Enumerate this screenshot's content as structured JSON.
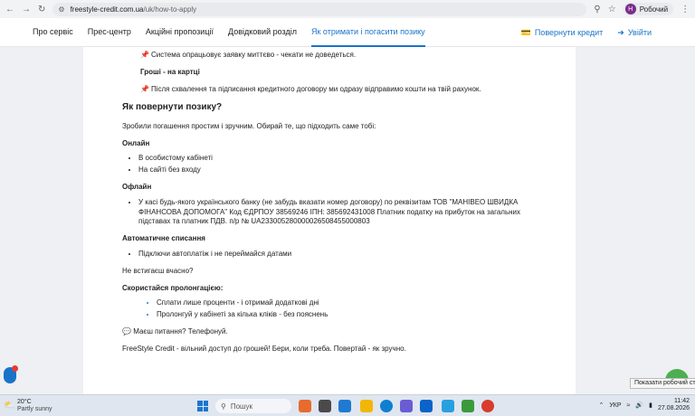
{
  "browser": {
    "url_domain": "freestyle-credit.com.ua",
    "url_path": "/uk/how-to-apply",
    "profile_initial": "Н",
    "profile_name": "Робочий"
  },
  "header": {
    "nav": [
      {
        "label": "Про сервіс"
      },
      {
        "label": "Прес-центр"
      },
      {
        "label": "Акційні пропозиції"
      },
      {
        "label": "Довідковий розділ"
      },
      {
        "label": "Як отримати і погасити позику"
      }
    ],
    "repay_label": "Повернути кредит",
    "login_label": "Увійти"
  },
  "content": {
    "line1": "Система опрацьовує заявку миттєво - чекати не доведеться.",
    "money_card_heading": "Гроші - на картці",
    "line2": "Після схвалення та підписання кредитного договору ми одразу відправимо кошти на твій рахунок.",
    "repay_heading": "Як повернути позику?",
    "repay_intro": "Зробили погашення простим і зручним. Обирай те, що підходить саме тобі:",
    "online_heading": "Онлайн",
    "online_items": [
      "В особистому кабінеті",
      "На сайті без входу"
    ],
    "offline_heading": "Офлайн",
    "offline_item": "У касі будь-якого українського банку (не забудь вказати номер договору) по реквізитам ТОВ \"МАНІВЕО ШВИДКА ФІНАНСОВА ДОПОМОГА\" Код ЄДРПОУ 38569246 ІПН: 385692431008 Платник податку на прибуток на загальних підставах та платник ПДВ. п/р № UA233005280000026508455000803",
    "auto_heading": "Автоматичне списання",
    "auto_item": "Підключи автоплатіж і не переймайся датами",
    "late_question": "Не встигаєш вчасно?",
    "prolong_heading": "Скористайся пролонгацією:",
    "prolong_items": [
      "Сплати лише проценти - і отримай додаткові дні",
      "Пролонгуй у кабінеті за кілька кліків - без пояснень"
    ],
    "questions": "Маєш питання? Телефонуй.",
    "footer_slogan": "FreeStyle Credit - вільний доступ до грошей! Бери, коли треба. Повертай - як зручно."
  },
  "tooltip": "Показати робочий стіл",
  "taskbar": {
    "temperature": "20°C",
    "weather": "Partly sunny",
    "search_placeholder": "Пошук",
    "language": "УКР",
    "time": "11:42",
    "date": "27.08.2026"
  },
  "colors": {
    "accent": "#1a73c8",
    "pin": "#d9263c",
    "chat": "#4caf50"
  }
}
